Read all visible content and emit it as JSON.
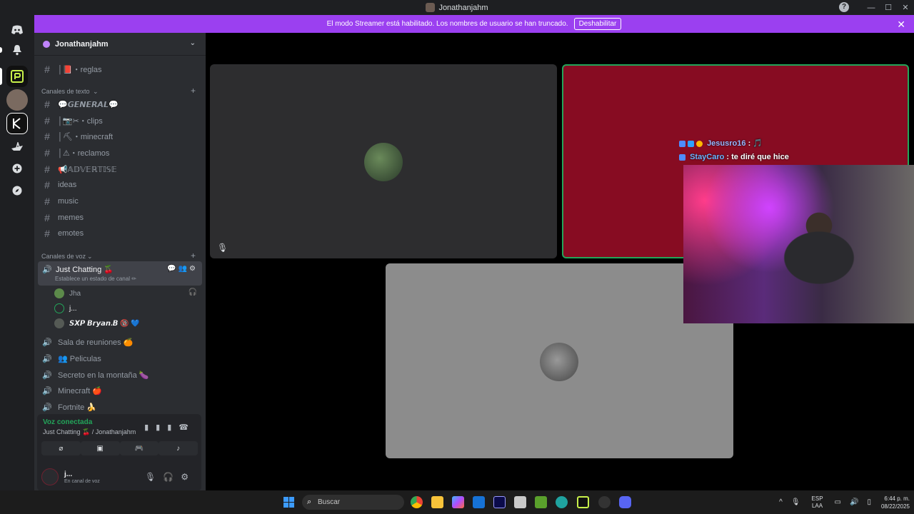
{
  "window": {
    "title": "Jonathanjahm",
    "help": "?",
    "minimize": "—",
    "maximize": "☐",
    "close": "✕"
  },
  "banner": {
    "text": "El modo Streamer está habilitado. Los nombres de usuario se han truncado.",
    "button": "Deshabilitar",
    "close": "✕"
  },
  "rail": {
    "items": [
      {
        "icon": "discord-icon"
      },
      {
        "icon": "bell-icon",
        "badge": "1"
      },
      {
        "icon": "server-p-icon"
      },
      {
        "icon": "server-avatar-icon"
      },
      {
        "icon": "server-k-icon"
      },
      {
        "icon": "server-ship-icon"
      },
      {
        "icon": "add-server-icon"
      },
      {
        "icon": "explore-icon"
      }
    ]
  },
  "sidebar": {
    "guild_name": "Jonathanjahm",
    "channels_top": [
      {
        "label": "│📕・reglas"
      }
    ],
    "text_category": "Canales de texto",
    "text_channels": [
      {
        "label": "💬𝙂𝙀𝙉𝙀𝙍𝘼𝙇💬"
      },
      {
        "label": "│📷✂・clips"
      },
      {
        "label": "│⛏・minecraft"
      },
      {
        "label": "│⚠・reclamos"
      },
      {
        "label": "📢𝔸𝔻𝕍𝔼ℝ𝕋𝕀𝕊𝔼"
      },
      {
        "label": "ideas"
      },
      {
        "label": "music"
      },
      {
        "label": "memes"
      },
      {
        "label": "emotes"
      }
    ],
    "voice_category": "Canales de voz",
    "active_voice": {
      "label": "Just Chatting 🍒",
      "status": "Establece un estado de canal ✏"
    },
    "voice_users": [
      {
        "name": "Jha",
        "color": "#5c8a4a"
      },
      {
        "name": "j...",
        "color": "#2a2b2f"
      },
      {
        "name": "𝙎𝙓𝙋 𝘽𝙧𝙮𝙖𝙣.𝘽 🔞 💙",
        "color": "#555a55"
      }
    ],
    "voice_channels": [
      {
        "label": "Sala de reuniones 🍊"
      },
      {
        "label": "👥 Peliculas"
      },
      {
        "label": "Secreto en la montaña 🍆"
      },
      {
        "label": "Minecraft 🍎"
      },
      {
        "label": "Fortnite 🍌"
      }
    ]
  },
  "voice_panel": {
    "title": "Voz conectada",
    "channel": "Just Chatting 🍒 / Jonathanjahm",
    "user_name": "j...",
    "user_status": "En canal de voz"
  },
  "stream_chat": [
    {
      "user": "Jesusro16",
      "message": ": 🎵"
    },
    {
      "user": "StayCaro",
      "message": ": te diré que hice"
    }
  ],
  "taskbar": {
    "search_placeholder": "Buscar",
    "lang_top": "ESP",
    "lang_bottom": "LAA",
    "time": "6:44 p. m.",
    "date": "08/22/2025"
  },
  "colors": {
    "accent_banner": "#9b40f0",
    "voice_connected": "#23a55a",
    "speaking_border": "#23a55a",
    "tile_red": "#870c22"
  }
}
